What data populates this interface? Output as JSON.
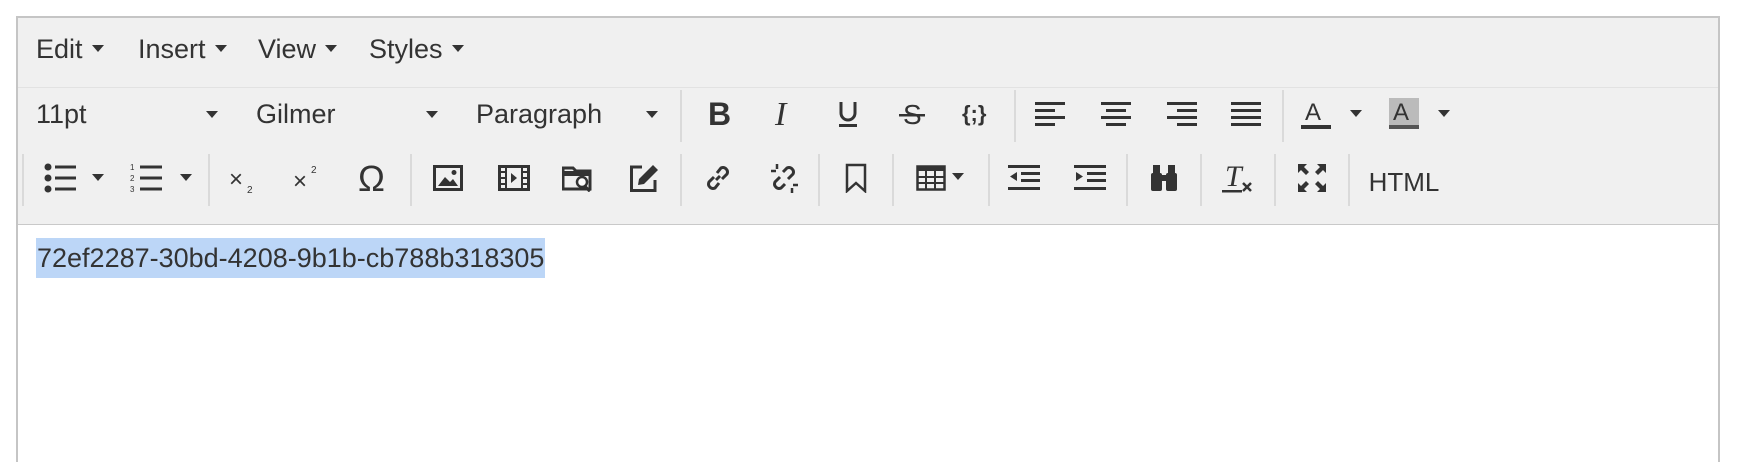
{
  "menubar": {
    "items": [
      {
        "label": "Edit"
      },
      {
        "label": "Insert"
      },
      {
        "label": "View"
      },
      {
        "label": "Styles"
      }
    ]
  },
  "toolbar": {
    "font_size": "11pt",
    "font_family": "Gilmer",
    "block_format": "Paragraph",
    "html_label": "HTML",
    "icons": [
      "bold-icon",
      "italic-icon",
      "underline-icon",
      "strikethrough-icon",
      "code-icon",
      "align-left-icon",
      "align-center-icon",
      "align-right-icon",
      "align-justify-icon",
      "text-color-icon",
      "background-color-icon",
      "bullet-list-icon",
      "numbered-list-icon",
      "subscript-icon",
      "superscript-icon",
      "omega-icon",
      "image-icon",
      "media-icon",
      "file-browser-icon",
      "edit-icon",
      "link-icon",
      "unlink-icon",
      "bookmark-icon",
      "table-icon",
      "outdent-icon",
      "indent-icon",
      "find-replace-icon",
      "clear-formatting-icon",
      "fullscreen-icon"
    ]
  },
  "content": {
    "text": "72ef2287-30bd-4208-9b1b-cb788b318305",
    "selection_color": "#bcd6f7"
  }
}
